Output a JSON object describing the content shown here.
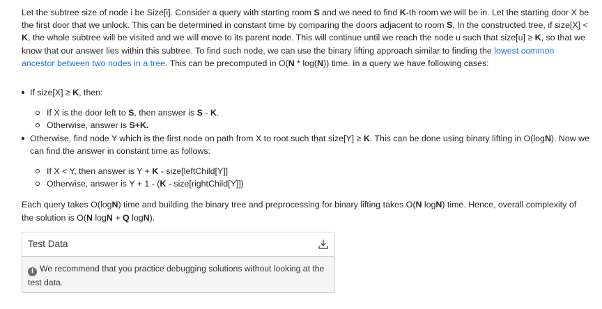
{
  "intro": {
    "t1": "Let the subtree size of node i be Size[i]. Consider a query with starting room ",
    "b1": "S",
    "t2": " and we need to find ",
    "b2": "K",
    "t3": "-th room we will be in. Let the starting door X be the first door that we unlock. This can be determined in constant time by comparing the doors adjacent to room ",
    "b3": "S",
    "t4": ". In the constructed tree, if size[X] < ",
    "b4": "K",
    "t5": ", the whole subtree will be visited and we will move to its parent node. This will continue until we reach the node u such that size[u] ≥ ",
    "b5": "K",
    "t6": ", so that we know that our answer lies within this subtree. To find such node, we can use the binary lifting approach similar to finding the ",
    "link": "lowest common ancestor between two nodes in a tree",
    "t7": ". This can be precomputed in O(",
    "b6": "N",
    "t8": " * log(",
    "b7": "N",
    "t9": ")) time. In a query we have following cases:"
  },
  "case1": {
    "t1": "If size[X] ≥ ",
    "b1": "K",
    "t2": ", then:",
    "sub1": {
      "t1": "If X is the door left to ",
      "b1": "S",
      "t2": ", then answer is ",
      "b2": "S",
      "t3": " - ",
      "b3": "K",
      "t4": "."
    },
    "sub2": {
      "t1": "Otherwise, answer is ",
      "b1": "S+K."
    }
  },
  "case2": {
    "t1": "Otherwise, find node Y which is the first node on path from X to root such that size[Y] ≥ ",
    "b1": "K",
    "t2": ". This can be done using binary lifting in O(log",
    "b2": "N",
    "t3": "). Now we can find the answer in constant time as follows:",
    "sub1": {
      "t1": "If X < Y, then answer is Y + ",
      "b1": "K",
      "t2": " - size[leftChild[Y]]"
    },
    "sub2": {
      "t1": "Otherwise, answer is Y + 1 - (",
      "b1": "K",
      "t2": " - size[rightChild[Y]])"
    }
  },
  "complexity": {
    "t1": "Each query takes O(log",
    "b1": "N",
    "t2": ") time and building the binary tree and preprocessing for binary lifting takes O(",
    "b2": "N",
    "t3": " log",
    "b3": "N",
    "t4": ") time. Hence, overall complexity of the solution is O(",
    "b4": "N",
    "t5": " log",
    "b5": "N",
    "t6": " + ",
    "b6": "Q",
    "t7": " log",
    "b7": "N",
    "t8": ")."
  },
  "test_data": {
    "title": "Test Data",
    "download_icon": "download-icon",
    "info_icon": "info-icon",
    "info_glyph": "i",
    "note": "We recommend that you practice debugging solutions without looking at the test data."
  },
  "colors": {
    "link": "#1a73e8",
    "text": "#262626",
    "panel_bg": "#f5f5f5",
    "border": "#d0d0d0"
  }
}
